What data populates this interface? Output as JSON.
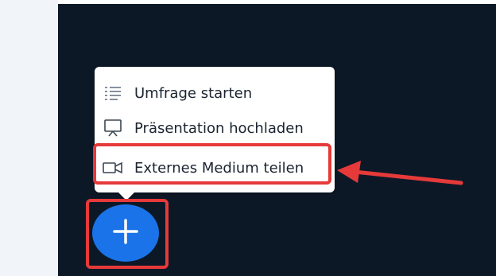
{
  "menu": {
    "items": [
      {
        "label": "Umfrage starten",
        "icon": "poll-list-icon"
      },
      {
        "label": "Präsentation hochladen",
        "icon": "presentation-screen-icon"
      },
      {
        "label": "Externes Medium teilen",
        "icon": "video-camera-icon"
      }
    ]
  },
  "fab": {
    "icon": "plus-icon"
  },
  "colors": {
    "highlight": "#e63a3a",
    "fab": "#1a73e8",
    "dark_bg": "#0d1827"
  }
}
